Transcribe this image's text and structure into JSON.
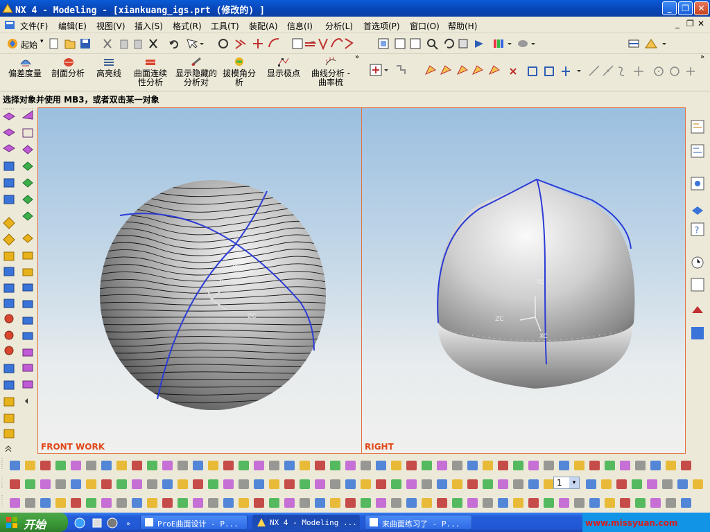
{
  "window": {
    "title": "NX 4 - Modeling - [xiankuang_igs.prt  (修改的) ]",
    "buttons": [
      "_",
      "❐",
      "✕"
    ]
  },
  "menubar": {
    "items": [
      "文件(F)",
      "编辑(E)",
      "视图(V)",
      "插入(S)",
      "格式(R)",
      "工具(T)",
      "装配(A)",
      "信息(I)",
      "分析(L)",
      "首选项(P)",
      "窗口(O)",
      "帮助(H)"
    ],
    "doc_buttons": [
      "_",
      "❐",
      "✕"
    ]
  },
  "toolbar_standard": {
    "start_label": "起始"
  },
  "analysis_toolbar": {
    "buttons": [
      {
        "label": "偏差度量"
      },
      {
        "label": "剖面分析"
      },
      {
        "label": "高亮线"
      },
      {
        "label": "曲面连续性分析"
      },
      {
        "label": "显示隐藏的分析对"
      },
      {
        "label": "拔模角分析"
      },
      {
        "label": "显示极点"
      },
      {
        "label": "曲线分析 - 曲率梳"
      }
    ]
  },
  "status_bar": {
    "prompt": "选择对象并使用 MB3，或者双击某一对象"
  },
  "viewports": [
    {
      "label": "FRONT WORK",
      "axes": [
        "XC",
        "YC",
        "ZC"
      ]
    },
    {
      "label": "RIGHT",
      "axes": [
        "YC",
        "ZC",
        "XC"
      ]
    }
  ],
  "bottom_toolbar": {
    "layer_value": "1"
  },
  "taskbar": {
    "start_label": "开始",
    "tasks": [
      {
        "label": "ProE曲面设计 - P...",
        "active": false
      },
      {
        "label": "NX 4 - Modeling ...",
        "active": true
      },
      {
        "label": "来曲面练习了 - P...",
        "active": false
      }
    ],
    "watermark": "www.missyuan.com"
  },
  "colors": {
    "title_blue": "#0a5bd6",
    "viewport_border": "#e3703f",
    "isocurve_blue": "#2b3bd6",
    "label_orange": "#e04818"
  }
}
